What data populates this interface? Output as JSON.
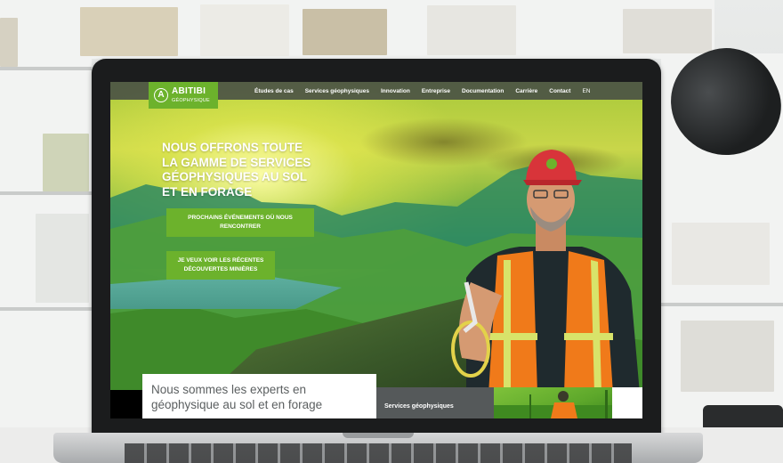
{
  "nav": {
    "logo": {
      "name": "ABITIBI",
      "sub": "GÉOPHYSIQUE",
      "mark": "A"
    },
    "items": [
      {
        "label": "Études de cas"
      },
      {
        "label": "Services géophysiques"
      },
      {
        "label": "Innovation"
      },
      {
        "label": "Entreprise"
      },
      {
        "label": "Documentation"
      },
      {
        "label": "Carrière"
      },
      {
        "label": "Contact"
      },
      {
        "label": "EN"
      }
    ]
  },
  "hero": {
    "headline_lines": [
      "NOUS OFFRONS TOUTE",
      "LA GAMME DE SERVICES",
      "GÉOPHYSIQUES AU SOL",
      "ET EN FORAGE"
    ],
    "cta_primary_lines": [
      "PROCHAINS ÉVÉNEMENTS OÙ NOUS",
      "RENCONTRER"
    ],
    "cta_secondary_lines": [
      "JE VEUX VOIR LES RÉCENTES",
      "DÉCOUVERTES MINIÈRES"
    ]
  },
  "about": {
    "lines": [
      "Nous sommes les experts en",
      "géophysique au sol et en forage"
    ]
  },
  "services_card": {
    "label": "Services géophysiques"
  },
  "colors": {
    "brand_green": "#6cb22c",
    "nav_bg": "#464c46",
    "card_gray": "#55595a",
    "vest_orange": "#f07a1a",
    "cap_red": "#d8343a"
  }
}
